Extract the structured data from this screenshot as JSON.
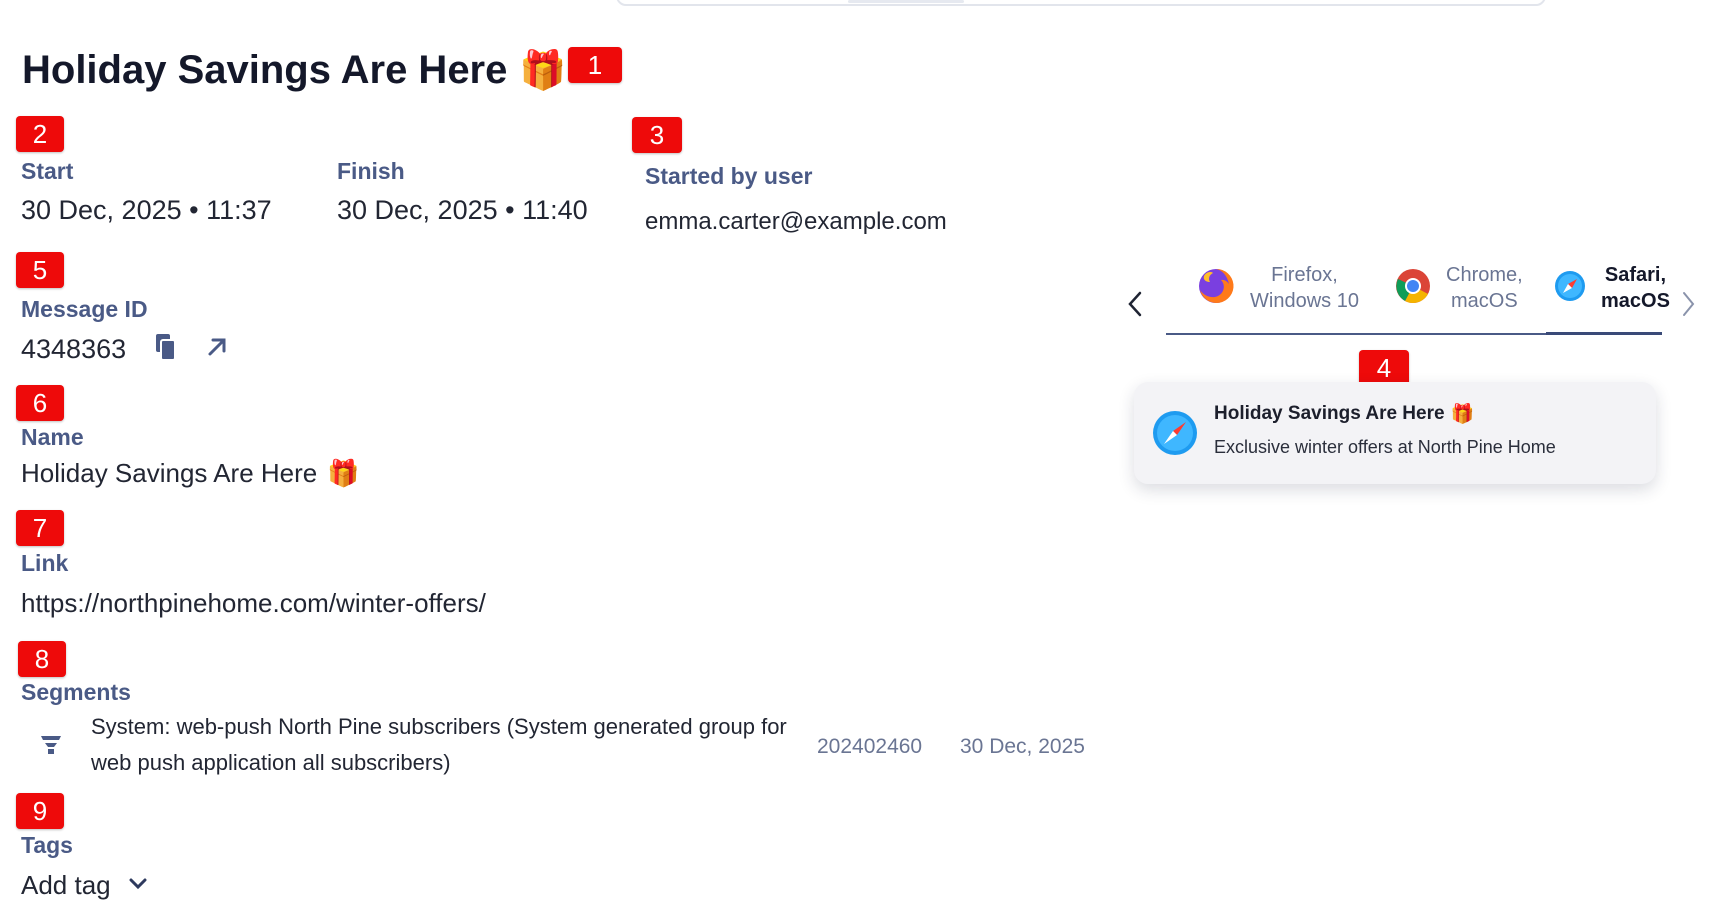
{
  "header": {
    "title": "Holiday Savings Are Here",
    "title_emoji": "🎁"
  },
  "markers": [
    "1",
    "2",
    "3",
    "4",
    "5",
    "6",
    "7",
    "8",
    "9"
  ],
  "schedule": {
    "start_label": "Start",
    "start_value": "30 Dec, 2025 • 11:37",
    "finish_label": "Finish",
    "finish_value": "30 Dec, 2025 • 11:40"
  },
  "started_by": {
    "label": "Started by user",
    "value": "emma.carter@example.com"
  },
  "message_id": {
    "label": "Message ID",
    "value": "4348363",
    "copy_icon": "copy-icon",
    "open_icon": "external-link-icon"
  },
  "name": {
    "label": "Name",
    "value": "Holiday Savings Are Here",
    "emoji": "🎁"
  },
  "link": {
    "label": "Link",
    "value": "https://northpinehome.com/winter-offers/"
  },
  "segments": {
    "label": "Segments",
    "items": [
      {
        "icon": "filter-icon",
        "name": "System: web-push North Pine subscribers (System generated group for web push application all subscribers)",
        "id": "202402460",
        "date": "30 Dec, 2025"
      }
    ]
  },
  "tags": {
    "label": "Tags",
    "add_label": "Add tag"
  },
  "preview": {
    "tabs": [
      {
        "line1": "Firefox,",
        "line2": "Windows 10",
        "icon": "firefox-icon",
        "active": false
      },
      {
        "line1": "Chrome,",
        "line2": "macOS",
        "icon": "chrome-icon",
        "active": false
      },
      {
        "line1": "Safari,",
        "line2": "macOS",
        "icon": "safari-icon",
        "active": true
      }
    ],
    "notification": {
      "title": "Holiday Savings Are Here",
      "emoji": "🎁",
      "body": "Exclusive winter offers at North Pine Home"
    }
  },
  "colors": {
    "marker": "#ee0a0a",
    "label": "#4a5a86",
    "accent": "#3a4a78"
  }
}
